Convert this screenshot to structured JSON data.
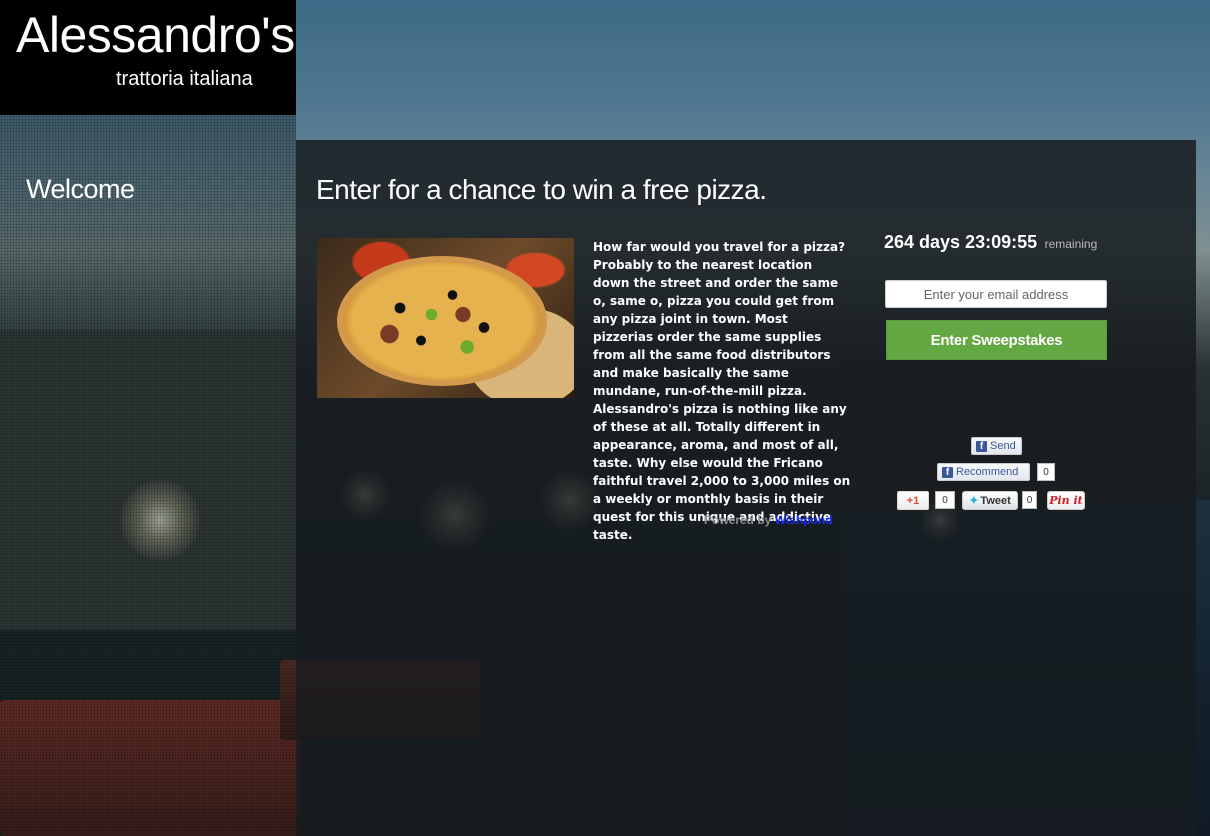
{
  "logo": {
    "name": "Alessandro's",
    "subtitle": "trattoria italiana"
  },
  "sidebar": {
    "title": "Welcome"
  },
  "main": {
    "title": "Enter for a chance to win a free pizza.",
    "image_alt": "pizza photo",
    "description": "How far would you travel for a pizza? Probably to the nearest location down the street and order the same o, same o, pizza you could get from any pizza joint in town. Most pizzerias order the same supplies from all the same food distributors and make basically the same mundane, run-of-the-mill pizza. Alessandro's pizza is nothing like any of these at all. Totally different in appearance, aroma, and most of all, taste. Why else would the Fricano faithful travel 2,000 to 3,000 miles on a weekly or monthly basis in their quest for this unique and addictive taste.",
    "powered_by": "Powered by",
    "powered_brand": "Wishpond"
  },
  "signup": {
    "countdown": "264 days 23:09:55",
    "remaining_label": "remaining",
    "email_placeholder": "Enter your email address",
    "submit_label": "Enter Sweepstakes",
    "submit_color": "#64a843"
  },
  "social": {
    "fb_send": "Send",
    "fb_recommend": "Recommend",
    "fb_recommend_count": "0",
    "gplus_label": "+1",
    "gplus_count": "0",
    "tweet_label": "Tweet",
    "tweet_count": "0",
    "pin_label": "Pin it"
  }
}
